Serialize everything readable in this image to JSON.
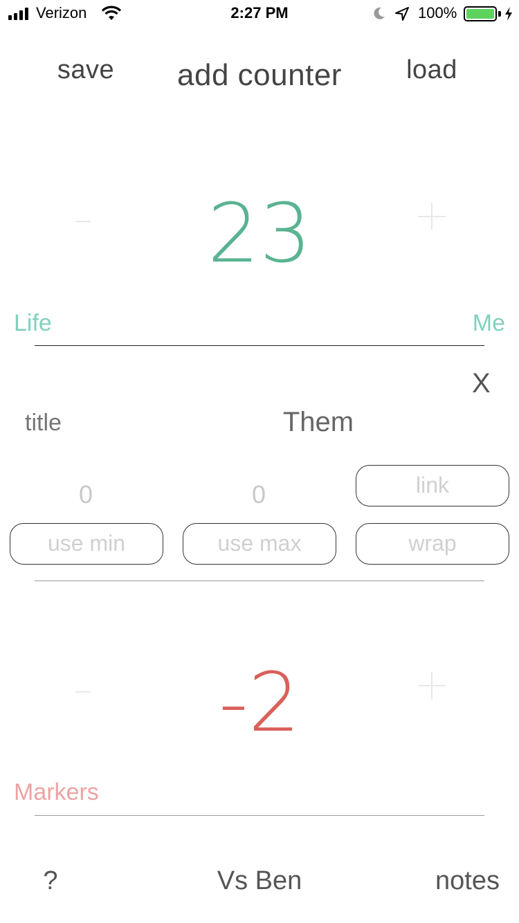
{
  "status_bar": {
    "carrier": "Verizon",
    "time": "2:27 PM",
    "battery_percent": "100%",
    "icons": [
      "signal-icon",
      "wifi-icon",
      "moon-icon",
      "location-icon",
      "battery-icon",
      "charging-icon"
    ],
    "battery_color": "#5ed35f"
  },
  "nav": {
    "save_label": "save",
    "add_counter_label": "add counter",
    "load_label": "load"
  },
  "counter_1": {
    "value": "23",
    "title": "Life",
    "owner": "Me",
    "color": "#5ab391"
  },
  "editor": {
    "close_label": "X",
    "title_placeholder": "title",
    "owner_value": "Them",
    "min_value": "0",
    "max_value": "0",
    "link_label": "link",
    "use_min_label": "use min",
    "use_max_label": "use max",
    "wrap_label": "wrap"
  },
  "counter_2": {
    "value": "-2",
    "title": "Markers",
    "color": "#d9605a"
  },
  "footer": {
    "help_label": "?",
    "opponent_label": "Vs Ben",
    "notes_label": "notes"
  }
}
